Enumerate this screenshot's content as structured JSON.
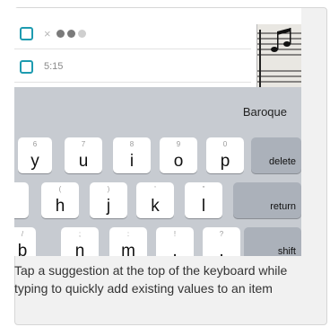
{
  "list": {
    "row1_mark": "×",
    "row2_time": "5:15"
  },
  "keyboard": {
    "suggestion": "Baroque",
    "row1": [
      {
        "hint": "6",
        "char": "y"
      },
      {
        "hint": "7",
        "char": "u"
      },
      {
        "hint": "8",
        "char": "i"
      },
      {
        "hint": "9",
        "char": "o"
      },
      {
        "hint": "0",
        "char": "p"
      }
    ],
    "row2": [
      {
        "hint": "(",
        "char": "h"
      },
      {
        "hint": ")",
        "char": "j"
      },
      {
        "hint": "'",
        "char": "k"
      },
      {
        "hint": "\"",
        "char": "l"
      }
    ],
    "row3": [
      {
        "hint": "/",
        "char": "b"
      },
      {
        "hint": ";",
        "char": "n"
      },
      {
        "hint": ":",
        "char": "m"
      },
      {
        "hint": "!",
        "char": ","
      },
      {
        "hint": "?",
        "char": "."
      }
    ],
    "delete_label": "delete",
    "return_label": "return",
    "shift_label": "shift"
  },
  "caption": "Tap a suggestion at the top of the keyboard while typing to quickly add existing values to an item",
  "colors": {
    "checkbox_accent": "#1e9bb0",
    "keyboard_bg": "#c7cbd1"
  }
}
